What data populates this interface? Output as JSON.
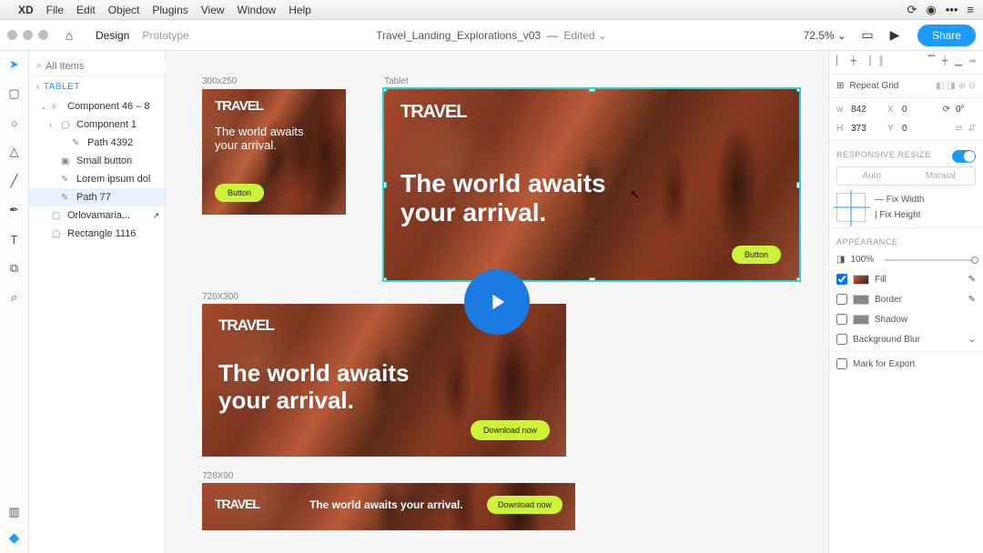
{
  "menubar": {
    "app": "XD",
    "items": [
      "File",
      "Edit",
      "Object",
      "Plugins",
      "View",
      "Window",
      "Help"
    ]
  },
  "toolbar": {
    "modes": {
      "design": "Design",
      "prototype": "Prototype"
    },
    "title": "Travel_Landing_Explorations_v03",
    "status": "Edited",
    "zoom": "72.5%",
    "share": "Share"
  },
  "search": {
    "placeholder": "All Items"
  },
  "breadcrumb": "TABLET",
  "layers": [
    {
      "name": "Component 46 – 8",
      "exp": "⌄",
      "icon": "⬨",
      "indent": 0
    },
    {
      "name": "Component 1",
      "exp": "›",
      "icon": "▢",
      "indent": 1
    },
    {
      "name": "Path 4392",
      "exp": "",
      "icon": "✎",
      "indent": 2
    },
    {
      "name": "Small button",
      "exp": "",
      "icon": "▣",
      "indent": 1
    },
    {
      "name": "Lorem ipsum dol",
      "exp": "",
      "icon": "✎",
      "indent": 1
    },
    {
      "name": "Path 77",
      "exp": "",
      "icon": "✎",
      "indent": 1,
      "selected": true
    },
    {
      "name": "Orlovamaria...",
      "exp": "",
      "icon": "▢",
      "indent": 0,
      "link": true
    },
    {
      "name": "Rectangle 1116",
      "exp": "",
      "icon": "▢",
      "indent": 0
    }
  ],
  "artboards": {
    "a1": {
      "label": "300x250",
      "logo": "TRAVEL",
      "tag": "The world awaits your arrival.",
      "cta": "Button"
    },
    "a2": {
      "label": "Tablet",
      "logo": "TRAVEL",
      "tag": "The world awaits your arrival.",
      "cta": "Button"
    },
    "a3": {
      "label": "720X300",
      "logo": "TRAVEL",
      "tag": "The world awaits your arrival.",
      "cta": "Download now"
    },
    "a4": {
      "label": "728X90",
      "logo": "TRAVEL",
      "tag": "The world awaits your arrival.",
      "cta": "Download now"
    }
  },
  "inspector": {
    "repeat": "Repeat Grid",
    "w": "842",
    "x": "0",
    "rot": "0°",
    "h": "373",
    "y": "0",
    "responsive_label": "RESPONSIVE RESIZE",
    "auto": "Auto",
    "manual": "Manual",
    "fixw": "Fix Width",
    "fixh": "Fix Height",
    "appearance_label": "APPEARANCE",
    "opacity": "100%",
    "fill": "Fill",
    "border": "Border",
    "shadow": "Shadow",
    "bgblur": "Background Blur",
    "export": "Mark for Export"
  }
}
